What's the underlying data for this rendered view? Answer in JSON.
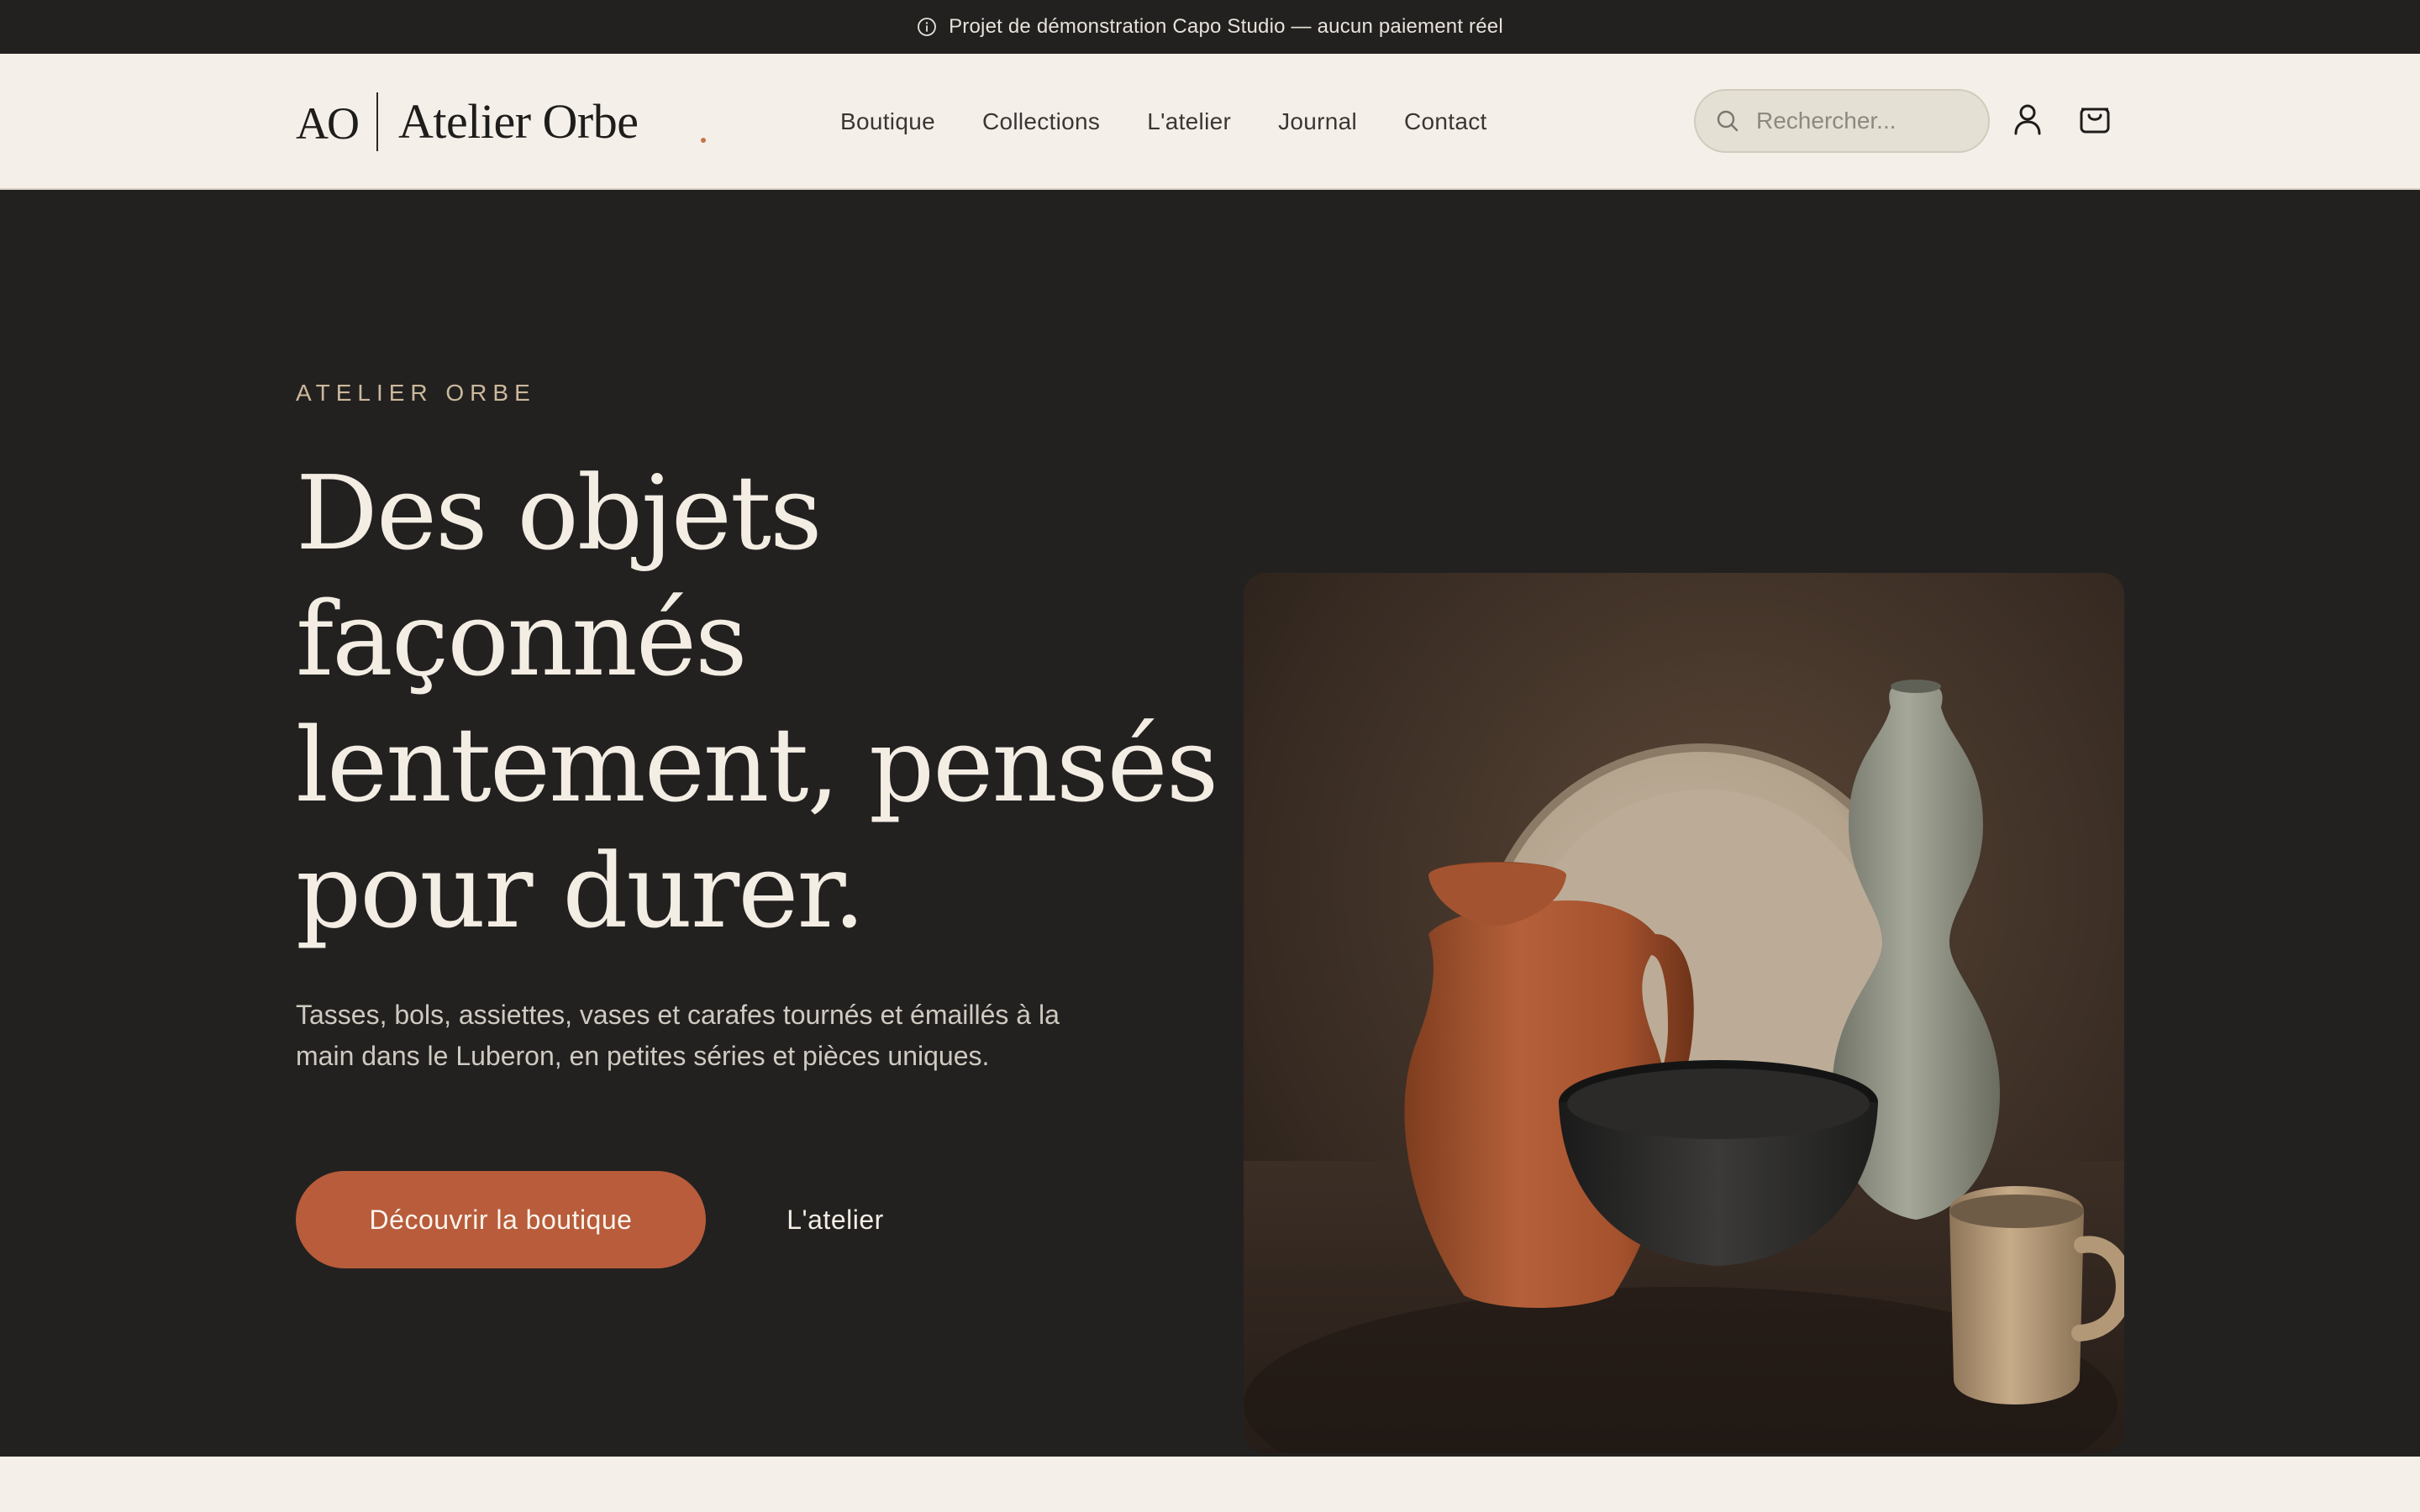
{
  "banner": {
    "icon": "info-icon",
    "text": "Projet de démonstration Capo Studio — aucun paiement réel"
  },
  "header": {
    "logo_mark": "AO",
    "logo_name": "Atelier Orbe",
    "nav": [
      {
        "label": "Boutique"
      },
      {
        "label": "Collections"
      },
      {
        "label": "L'atelier"
      },
      {
        "label": "Journal"
      },
      {
        "label": "Contact"
      }
    ],
    "search": {
      "placeholder": "Rechercher...",
      "value": "",
      "icon": "search-icon"
    },
    "account_icon": "user-icon",
    "cart_icon": "shopping-bag-icon"
  },
  "hero": {
    "eyebrow": "ATELIER ORBE",
    "headline_lines": [
      "Des objets",
      "façonnés",
      "lentement, pensés",
      "pour durer."
    ],
    "lead": "Tasses, bols, assiettes, vases et carafes tournés et émaillés à la main dans le Luberon, en petites séries et pièces uniques.",
    "cta_primary": "Découvrir la boutique",
    "cta_secondary": "L'atelier",
    "image_subjects": [
      "terracotta pitcher",
      "beige plate",
      "sage vase",
      "black bowl",
      "speckled mug"
    ]
  },
  "colors": {
    "dark_bg": "#222120",
    "cream_bg": "#f4efe9",
    "accent": "#b85c3b",
    "eyebrow": "#cdb89c",
    "headline": "#f3ede4"
  }
}
